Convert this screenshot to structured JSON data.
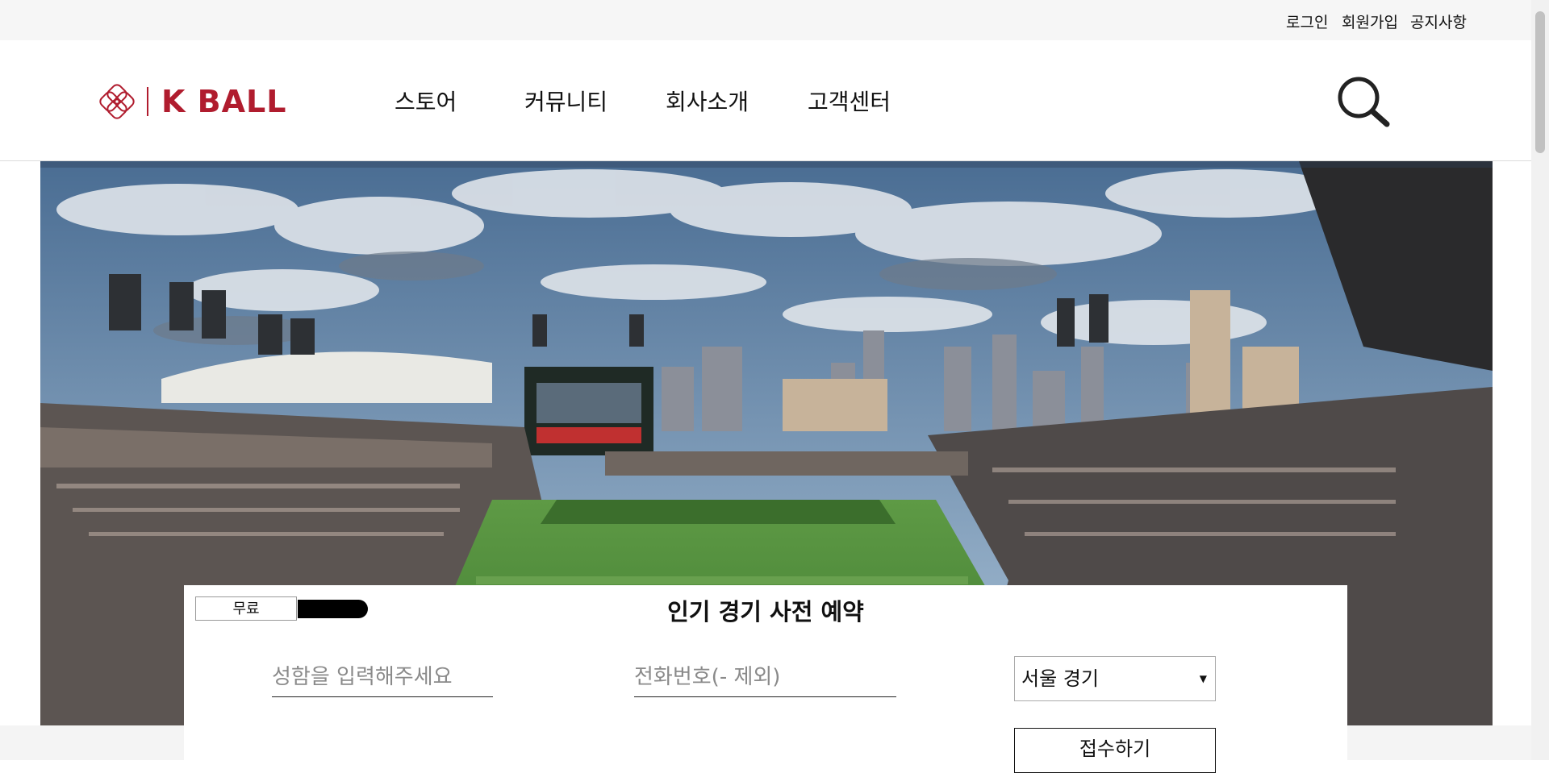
{
  "topbar": {
    "login": "로그인",
    "signup": "회원가입",
    "notice": "공지사항"
  },
  "header": {
    "brand": "K BALL",
    "nav": [
      "스토어",
      "커뮤니티",
      "회사소개",
      "고객센터"
    ]
  },
  "hero": {
    "slides": 3,
    "active_slide": 1
  },
  "booking": {
    "tag": "무료",
    "title": "인기 경기 사전 예약",
    "name_placeholder": "성함을 입력해주세요",
    "phone_placeholder": "전화번호(- 제외)",
    "region_selected": "서울 경기",
    "submit_label": "접수하기"
  },
  "colors": {
    "brand": "#b01c2e",
    "topbar_bg": "#f6f6f6"
  }
}
